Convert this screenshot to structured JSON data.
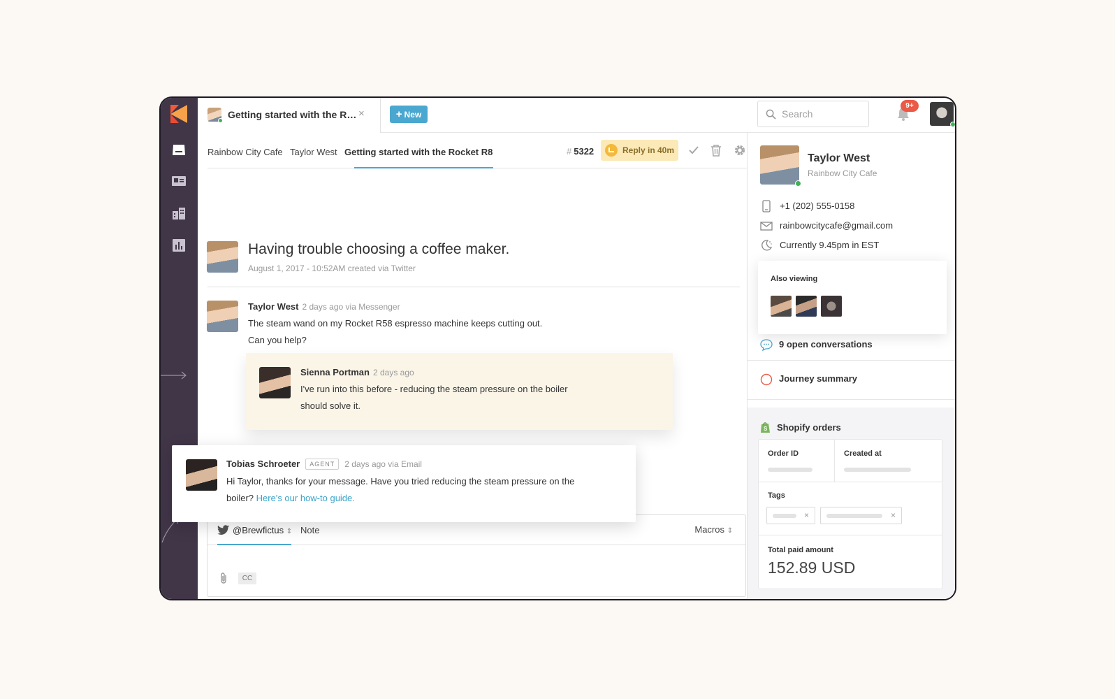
{
  "accent": "#4aa7cf",
  "brand": {
    "logo": "kustomer-logo"
  },
  "rail": [
    "inbox-icon",
    "contact-card-icon",
    "company-icon",
    "reports-icon"
  ],
  "tab": {
    "title": "Getting started with the R…",
    "close": "×"
  },
  "new_button": "New",
  "search": {
    "placeholder": "Search"
  },
  "notifications": {
    "badge": "9+"
  },
  "breadcrumb": {
    "items": [
      "Rainbow City Cafe",
      "Taylor West",
      "Getting started with the Rocket R8"
    ],
    "ticket_hash": "#",
    "ticket_number": "5322",
    "reply_label": "Reply in 40m"
  },
  "conversation": {
    "title": "Having trouble choosing a coffee maker.",
    "meta": "August 1, 2017 - 10:52AM created via Twitter"
  },
  "message1": {
    "name": "Taylor West",
    "meta": "2 days ago via Messenger",
    "line1": "The steam wand on my Rocket R58 espresso machine keeps cutting out.",
    "line2": "Can you help?"
  },
  "note": {
    "name": "Sienna Portman",
    "meta": "2 days ago",
    "line1": "I've run into this before - reducing the steam pressure on the boiler",
    "line2": "should solve it."
  },
  "agent_message": {
    "name": "Tobias Schroeter",
    "tag": "AGENT",
    "meta": "2 days ago via Email",
    "line1": "Hi Taylor, thanks for your message. Have you tried reducing the steam pressure on the",
    "line2_prefix": "boiler?",
    "link": "Here's our how-to guide."
  },
  "composer": {
    "handle": "@Brewfictus",
    "handle_caret": "⇕",
    "note_tab": "Note",
    "macros": "Macros",
    "macros_caret": "⇕",
    "cc": "CC"
  },
  "customer": {
    "name": "Taylor West",
    "company": "Rainbow City Cafe",
    "phone": "+1 (202) 555-0158",
    "email": "rainbowcitycafe@gmail.com",
    "local_time": "Currently 9.45pm in EST"
  },
  "also_viewing": {
    "title": "Also viewing"
  },
  "open_conversations": "9 open conversations",
  "journey": "Journey summary",
  "shopify": {
    "title": "Shopify orders",
    "order_id_label": "Order ID",
    "created_at_label": "Created at",
    "tags_label": "Tags",
    "tag_remove": "×",
    "total_label": "Total paid amount",
    "total_value": "152.89 USD"
  }
}
